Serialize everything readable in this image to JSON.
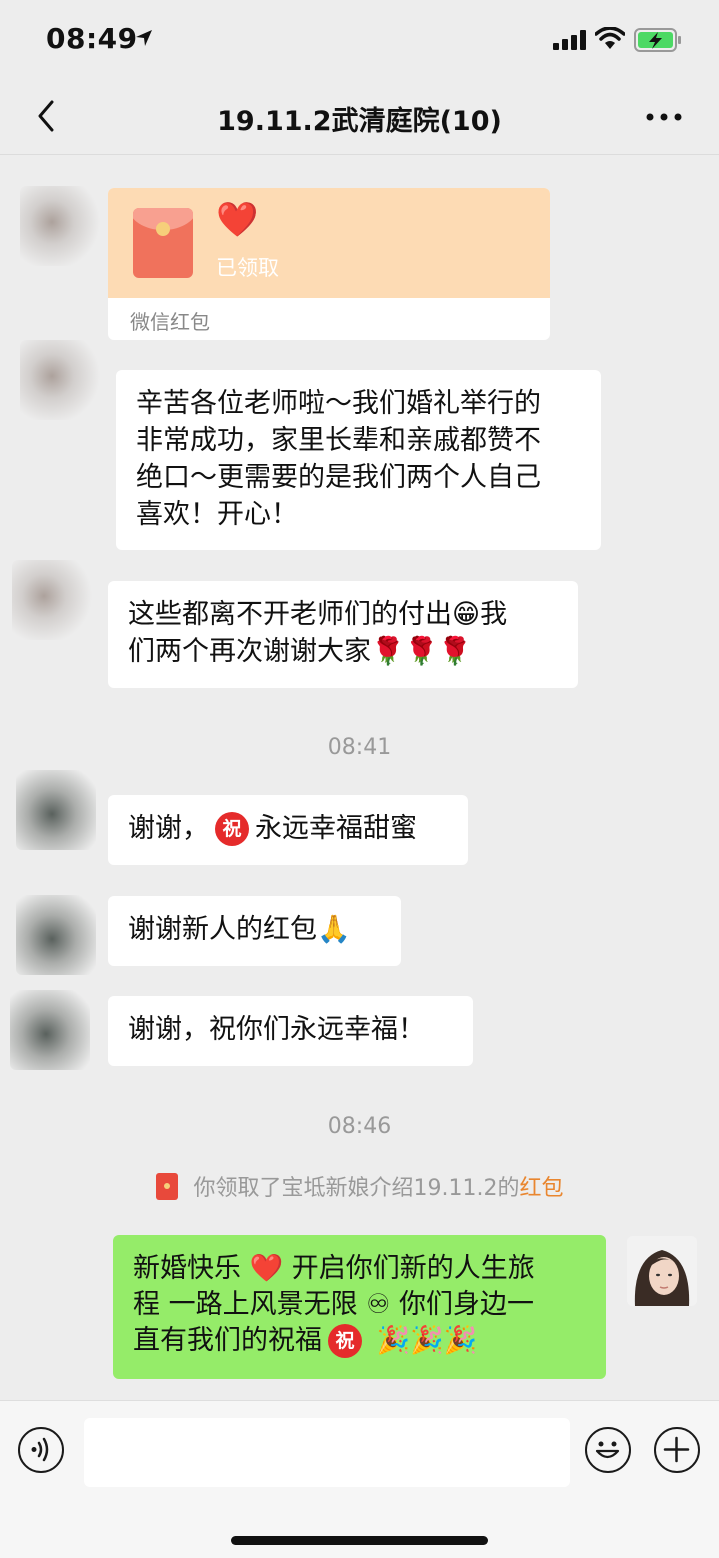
{
  "status_bar": {
    "time": "08:49"
  },
  "header": {
    "title": "19.11.2武清庭院(10)"
  },
  "messages": {
    "red_packet": {
      "note": "❤️",
      "status": "已领取",
      "footer": "微信红包"
    },
    "m1": "辛苦各位老师啦～我们婚礼举行的\n非常成功，家里长辈和亲戚都赞不\n绝口～更需要的是我们两个人自己\n喜欢！开心！",
    "m2a": "这些都离不开老师们的付出😁我",
    "m2b": "们两个再次谢谢大家🌹🌹🌹",
    "time1": "08:41",
    "m3a": "谢谢，",
    "m3_icon": "祝",
    "m3b": "永远幸福甜蜜",
    "m4a": "谢谢新人的红包",
    "m4_emoji": "🙏",
    "m5": "谢谢，祝你们永远幸福！",
    "time2": "08:46",
    "notice_text": "你领取了宝坻新娘介绍19.11.2的",
    "notice_link": "红包",
    "self_a": "新婚快乐 ",
    "self_heart": "❤️",
    "self_b": " 开启你们新的人生旅\n程 一路上风景无限 ♾ 你们身边一\n直有我们的祝福",
    "self_icon": "祝",
    "self_c": " 🎉🎉🎉"
  },
  "icons": {
    "back": "chevron-left-icon",
    "more": "ellipsis-icon",
    "voice": "voice-icon",
    "emoji": "smiley-icon",
    "plus": "plus-icon"
  },
  "colors": {
    "background": "#ededed",
    "self_bubble": "#95ec69",
    "red_packet_top": "#fddbb4",
    "link": "#e9862f"
  }
}
